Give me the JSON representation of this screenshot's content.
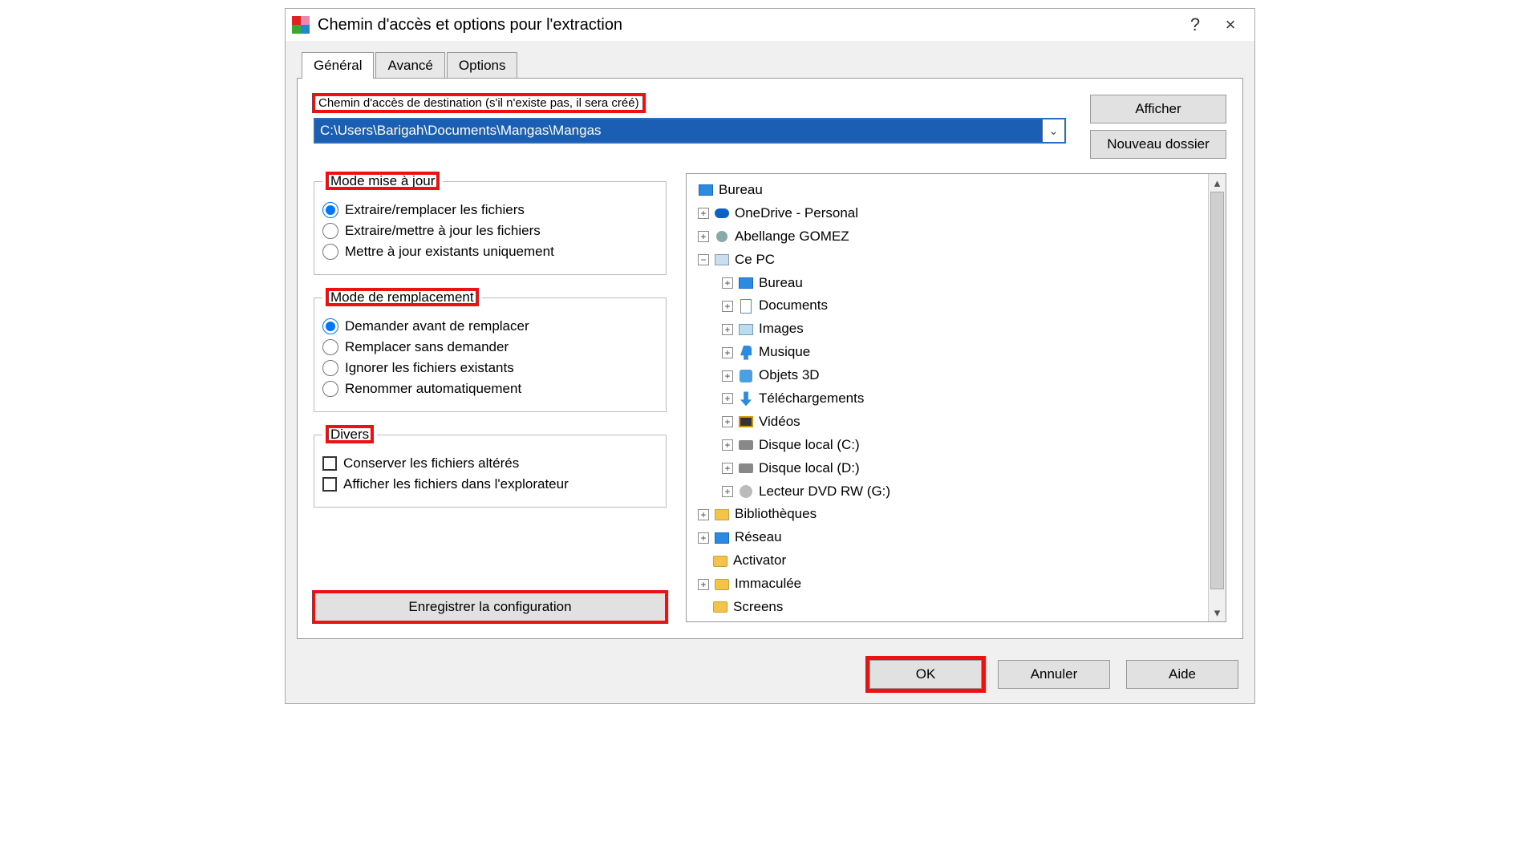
{
  "window": {
    "title": "Chemin d'accès et options pour l'extraction",
    "help": "?",
    "close": "×"
  },
  "tabs": {
    "general": "Général",
    "advanced": "Avancé",
    "options": "Options"
  },
  "dest": {
    "label": "Chemin d'accès de destination (s'il n'existe pas, il sera créé)",
    "value": "C:\\Users\\Barigah\\Documents\\Mangas\\Mangas"
  },
  "buttons": {
    "display": "Afficher",
    "new_folder": "Nouveau dossier",
    "save_config": "Enregistrer la configuration",
    "ok": "OK",
    "cancel": "Annuler",
    "help": "Aide"
  },
  "update_mode": {
    "legend": "Mode mise à jour",
    "opt1": "Extraire/remplacer les fichiers",
    "opt2": "Extraire/mettre à jour les fichiers",
    "opt3": "Mettre à jour existants uniquement"
  },
  "overwrite_mode": {
    "legend": "Mode de remplacement",
    "opt1": "Demander avant de remplacer",
    "opt2": "Remplacer sans demander",
    "opt3": "Ignorer les fichiers existants",
    "opt4": "Renommer automatiquement"
  },
  "misc": {
    "legend": "Divers",
    "opt1": "Conserver les fichiers altérés",
    "opt2": "Afficher les fichiers dans l'explorateur"
  },
  "tree": {
    "bureau": "Bureau",
    "onedrive": "OneDrive - Personal",
    "user": "Abellange GOMEZ",
    "thispc": "Ce PC",
    "pc_bureau": "Bureau",
    "pc_docs": "Documents",
    "pc_images": "Images",
    "pc_music": "Musique",
    "pc_3d": "Objets 3D",
    "pc_dl": "Téléchargements",
    "pc_videos": "Vidéos",
    "pc_c": "Disque local (C:)",
    "pc_d": "Disque local (D:)",
    "pc_g": "Lecteur DVD RW (G:)",
    "libs": "Bibliothèques",
    "network": "Réseau",
    "activator": "Activator",
    "immaculee": "Immaculée",
    "screens": "Screens"
  }
}
